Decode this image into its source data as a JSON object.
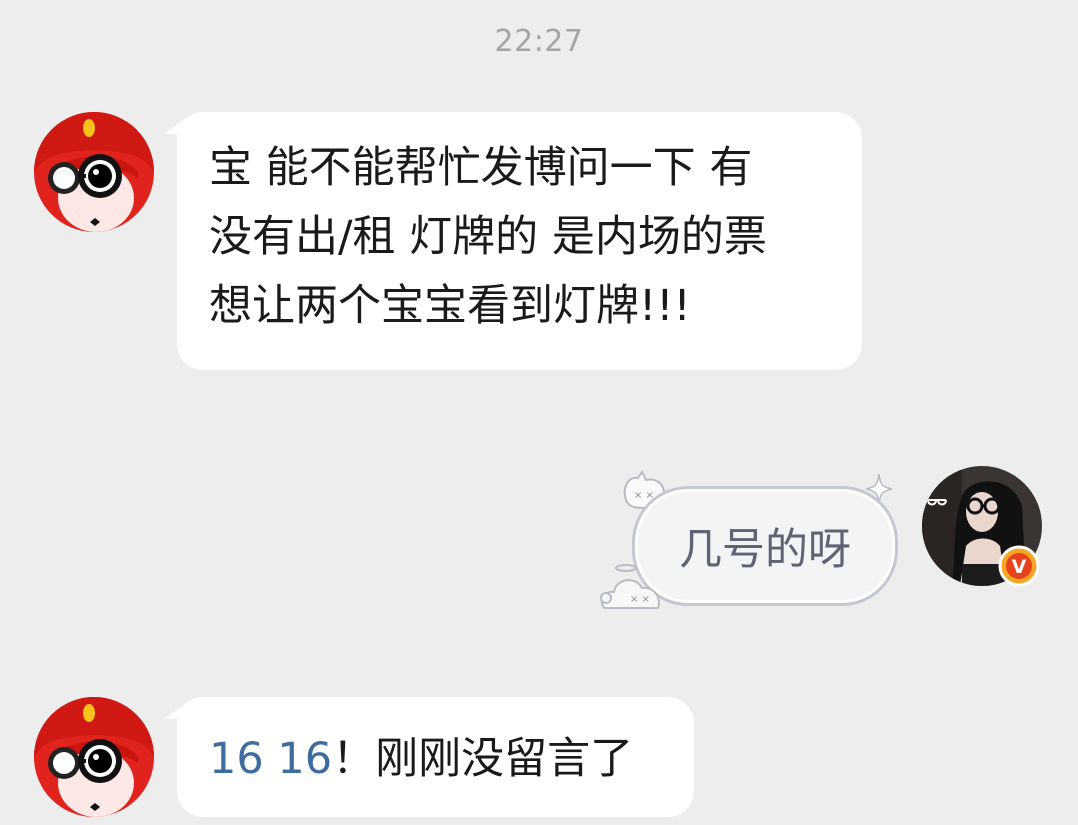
{
  "timestamp": "22:27",
  "messages": [
    {
      "sender": "other",
      "text_lines": [
        "宝 能不能帮忙发博问一下 有",
        "没有出/租 灯牌的 是内场的票",
        "想让两个宝宝看到灯牌!!!"
      ]
    },
    {
      "sender": "self",
      "text": "几号的呀",
      "badge": "V"
    },
    {
      "sender": "other",
      "num1": "16",
      "num2": "16",
      "rest": "！刚刚没留言了"
    }
  ],
  "colors": {
    "background": "#ededed",
    "bubble_other": "#ffffff",
    "bubble_self_border": "#c4c8d0",
    "number_link": "#3f6c9e",
    "timestamp": "#a5a5a5",
    "vip_badge": "#f5a623"
  },
  "icons": {
    "left_avatar": "red-hair-cartoon-avatar",
    "right_avatar": "girl-with-glasses-avatar",
    "bubble_deco_top": "cat-face-sticker-icon",
    "bubble_deco_bottom": "ghost-sticker-icon",
    "sparkle": "sparkle-icon"
  }
}
